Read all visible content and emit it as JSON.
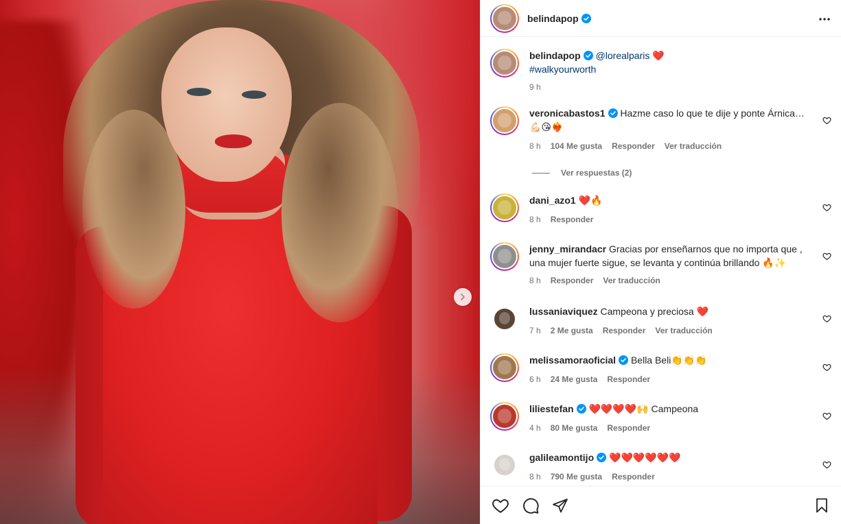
{
  "header": {
    "username": "belindapop",
    "verified": true,
    "more_icon": "more-horizontal-icon"
  },
  "caption": {
    "username": "belindapop",
    "mention": "@lorealparis",
    "emoji": "❤️",
    "hashtag": "#walkyourworth",
    "time": "9 h"
  },
  "comments": [
    {
      "username": "veronicabastos1",
      "verified": true,
      "text_line1": "Hazme caso lo que te dije y ponte Árnica…",
      "text_line2": "💪🏻😘❤️‍🔥",
      "time": "8 h",
      "likes": "104 Me gusta",
      "reply": "Responder",
      "translate": "Ver traducción",
      "view_replies": "Ver respuestas (2)"
    },
    {
      "username": "dani_azo1",
      "verified": false,
      "text": "❤️🔥",
      "time": "8 h",
      "reply": "Responder"
    },
    {
      "username": "jenny_mirandacr",
      "verified": false,
      "text_line1": "Gracias por enseñarnos que no importa que ,",
      "text_line2": "una mujer fuerte sigue, se levanta y continúa brillando 🔥✨",
      "time": "8 h",
      "reply": "Responder",
      "translate": "Ver traducción"
    },
    {
      "username": "lussaniaviquez",
      "verified": false,
      "text": "Campeona y preciosa ❤️",
      "time": "7 h",
      "likes": "2 Me gusta",
      "reply": "Responder",
      "translate": "Ver traducción"
    },
    {
      "username": "melissamoraoficial",
      "verified": true,
      "text": "Bella Beli👏👏👏",
      "time": "6 h",
      "likes": "24 Me gusta",
      "reply": "Responder"
    },
    {
      "username": "liliestefan",
      "verified": true,
      "text": "❤️❤️❤️❤️🙌 Campeona",
      "time": "4 h",
      "likes": "80 Me gusta",
      "reply": "Responder"
    },
    {
      "username": "galileamontijo",
      "verified": true,
      "text": "❤️❤️❤️❤️❤️❤️",
      "time": "8 h",
      "likes": "790 Me gusta",
      "reply": "Responder"
    }
  ],
  "colors": {
    "verified": "#0095f6",
    "text": "#262626",
    "muted": "#737373",
    "link": "#00376b",
    "dress_red": "#dd2021"
  },
  "icons": {
    "like": "heart-icon",
    "comment": "comment-icon",
    "share": "send-icon",
    "save": "bookmark-icon",
    "next": "chevron-right-icon"
  }
}
